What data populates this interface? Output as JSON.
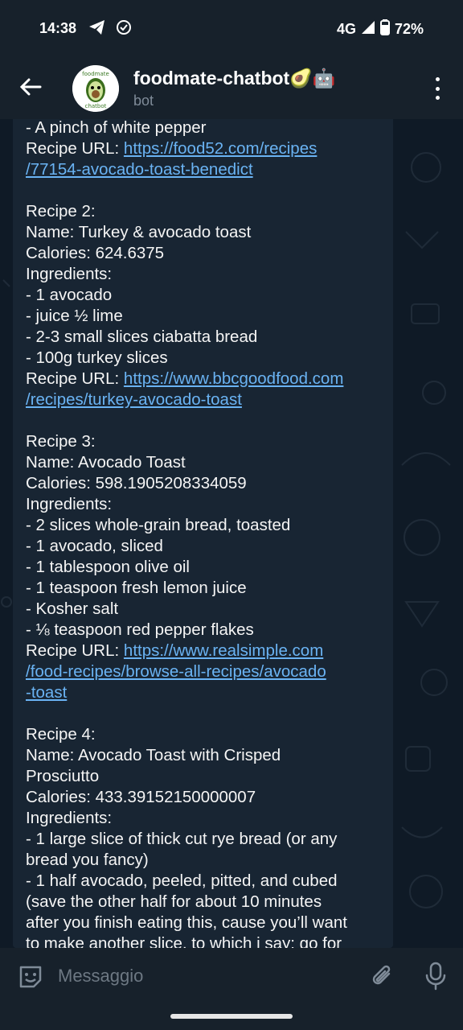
{
  "status_bar": {
    "time": "14:38",
    "network": "4G",
    "battery": "72%",
    "left_icons": [
      "telegram-icon",
      "check-circle-icon"
    ],
    "right_icons": [
      "signal-icon",
      "battery-icon"
    ]
  },
  "header": {
    "title": "foodmate-chatbot🥑🤖",
    "subtitle": "bot",
    "avatar_text_top": "foodmate",
    "avatar_text_bottom": "chatbot"
  },
  "message": {
    "lines": [
      {
        "text": "- A pinch of white pepper"
      },
      {
        "text": "Recipe URL: ",
        "link": "https://food52.com/recipes"
      },
      {
        "link": "/77154-avocado-toast-benedict"
      },
      {
        "text": ""
      },
      {
        "text": "Recipe 2:"
      },
      {
        "text": "Name: Turkey & avocado toast"
      },
      {
        "text": "Calories: 624.6375"
      },
      {
        "text": "Ingredients:"
      },
      {
        "text": "- 1 avocado"
      },
      {
        "text": "- juice ½ lime"
      },
      {
        "text": "- 2-3 small slices ciabatta bread"
      },
      {
        "text": "- 100g turkey slices"
      },
      {
        "text": "Recipe URL: ",
        "link": "https://www.bbcgoodfood.com"
      },
      {
        "link": "/recipes/turkey-avocado-toast"
      },
      {
        "text": ""
      },
      {
        "text": "Recipe 3:"
      },
      {
        "text": "Name: Avocado Toast"
      },
      {
        "text": "Calories: 598.1905208334059"
      },
      {
        "text": "Ingredients:"
      },
      {
        "text": "- 2 slices whole-grain bread, toasted"
      },
      {
        "text": "- 1 avocado, sliced"
      },
      {
        "text": "- 1 tablespoon olive oil"
      },
      {
        "text": "- 1 teaspoon fresh lemon juice"
      },
      {
        "text": "- Kosher salt"
      },
      {
        "text": "- ⅛ teaspoon red pepper flakes"
      },
      {
        "text": "Recipe URL: ",
        "link": "https://www.realsimple.com"
      },
      {
        "link": "/food-recipes/browse-all-recipes/avocado"
      },
      {
        "link": "-toast"
      },
      {
        "text": ""
      },
      {
        "text": "Recipe 4:"
      },
      {
        "text": "Name: Avocado Toast with Crisped"
      },
      {
        "text": "Prosciutto"
      },
      {
        "text": "Calories: 433.39152150000007"
      },
      {
        "text": "Ingredients:"
      },
      {
        "text": "- 1 large slice of thick cut rye bread (or any"
      },
      {
        "text": "bread you fancy)"
      },
      {
        "text": "- 1 half avocado, peeled, pitted, and cubed"
      },
      {
        "text": "(save the other half for about 10 minutes"
      },
      {
        "text": "after you finish eating this, cause you’ll want"
      },
      {
        "text": "to make another slice, to which i say: go for"
      }
    ]
  },
  "composer": {
    "placeholder": "Messaggio"
  },
  "colors": {
    "background": "#0e1621",
    "header": "#17212b",
    "bubble": "#182533",
    "link": "#6ab3f3",
    "muted": "#7f8b98"
  }
}
